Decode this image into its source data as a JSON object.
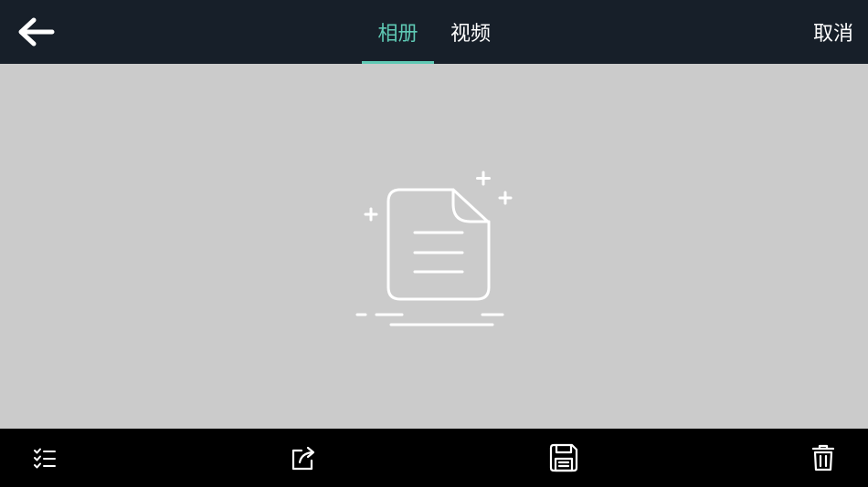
{
  "header": {
    "back_icon": "arrow-left-icon",
    "tabs": [
      {
        "label": "相册",
        "active": true
      },
      {
        "label": "视频",
        "active": false
      }
    ],
    "cancel_label": "取消"
  },
  "empty_state": {
    "icon": "empty-document-icon"
  },
  "toolbar": {
    "items": [
      {
        "icon": "checklist-icon",
        "action": "select"
      },
      {
        "icon": "share-icon",
        "action": "share"
      },
      {
        "icon": "save-icon",
        "action": "save"
      },
      {
        "icon": "trash-icon",
        "action": "delete"
      }
    ]
  },
  "colors": {
    "header_bg": "#171f29",
    "accent": "#5fc9b4",
    "content_bg": "#cbcbcb",
    "toolbar_bg": "#000000",
    "text": "#ffffff"
  }
}
